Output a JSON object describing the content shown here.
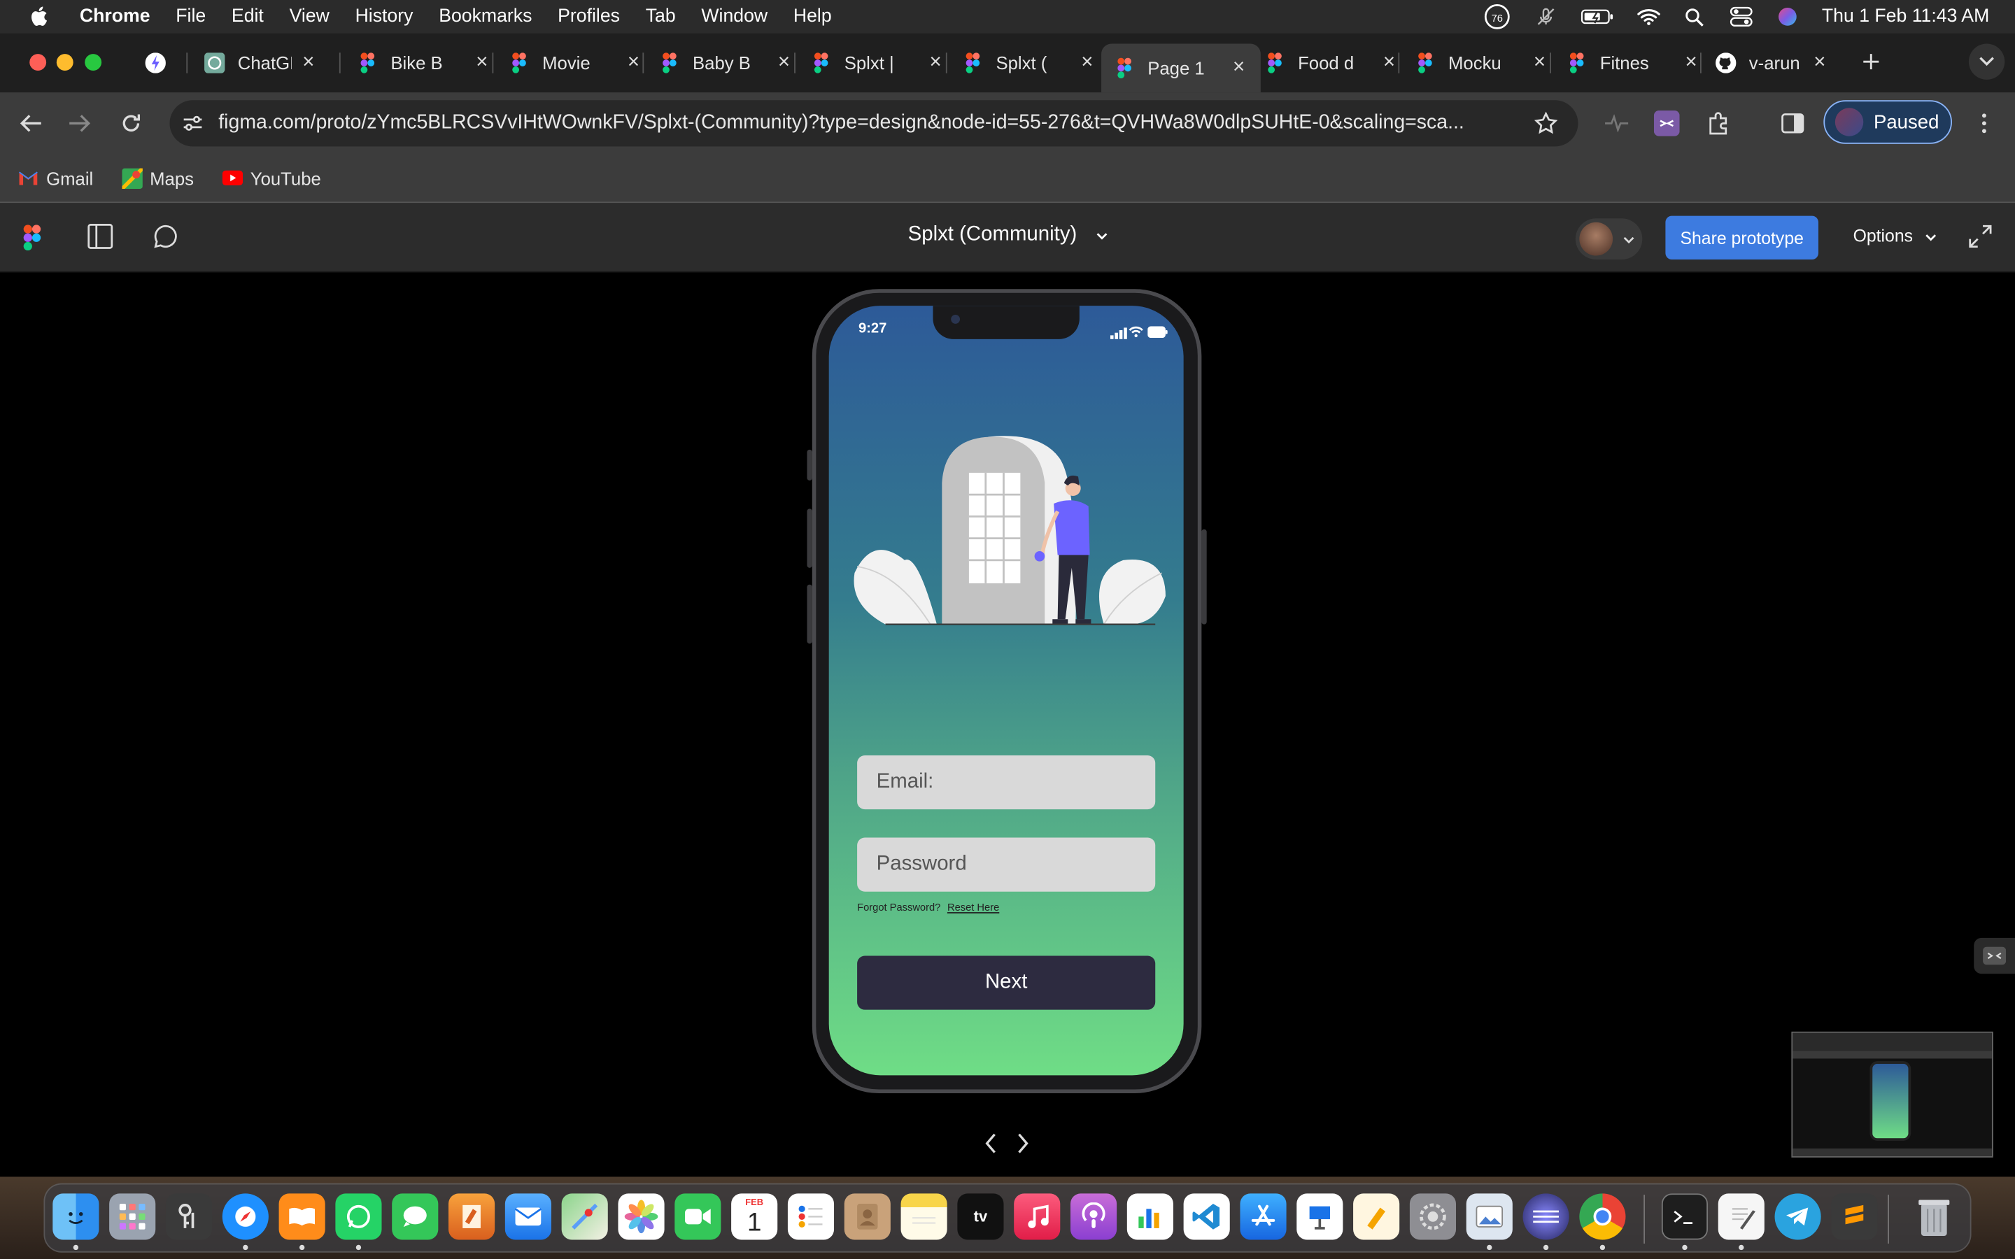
{
  "menubar": {
    "app": "Chrome",
    "items": [
      "File",
      "Edit",
      "View",
      "History",
      "Bookmarks",
      "Profiles",
      "Tab",
      "Window",
      "Help"
    ],
    "notification_count": "76",
    "clock": "Thu 1 Feb  11:43 AM"
  },
  "tabs": [
    {
      "title": "",
      "icon": "bolt-icon"
    },
    {
      "title": "ChatGPT",
      "icon": "chatgpt-icon"
    },
    {
      "title": "Bike B",
      "icon": "figma-icon"
    },
    {
      "title": "Movie",
      "icon": "figma-icon"
    },
    {
      "title": "Baby B",
      "icon": "figma-icon"
    },
    {
      "title": "Splxt |",
      "icon": "figma-icon"
    },
    {
      "title": "Splxt (",
      "icon": "figma-icon"
    },
    {
      "title": "Page 1",
      "icon": "figma-icon",
      "active": true
    },
    {
      "title": "Food d",
      "icon": "figma-icon"
    },
    {
      "title": "Mocku",
      "icon": "figma-icon"
    },
    {
      "title": "Fitnes",
      "icon": "figma-icon"
    },
    {
      "title": "v-arun",
      "icon": "github-icon"
    }
  ],
  "address_bar": {
    "url": "figma.com/proto/zYmc5BLRCSVvIHtWOwnkFV/Splxt-(Community)?type=design&node-id=55-276&t=QVHWa8W0dlpSUHtE-0&scaling=sca..."
  },
  "profile": {
    "label": "Paused"
  },
  "bookmarks": [
    {
      "label": "Gmail",
      "icon": "gmail-icon"
    },
    {
      "label": "Maps",
      "icon": "maps-icon"
    },
    {
      "label": "YouTube",
      "icon": "youtube-icon"
    }
  ],
  "figma": {
    "title": "Splxt (Community)",
    "share_label": "Share prototype",
    "options_label": "Options"
  },
  "phone": {
    "time": "9:27",
    "email_placeholder": "Email:",
    "password_placeholder": "Password",
    "forgot_text": "Forgot Password?",
    "reset_text": "Reset Here",
    "next_label": "Next"
  },
  "dock": {
    "calendar_month": "FEB",
    "calendar_day": "1",
    "tv_label": "tv",
    "apps": [
      "finder-icon",
      "launchpad-icon",
      "keychain-icon",
      "safari-icon",
      "books-icon",
      "whatsapp-icon",
      "messages-icon",
      "pages-icon",
      "mail-icon",
      "maps-icon",
      "photos-icon",
      "facetime-icon",
      "calendar-icon",
      "reminders-icon",
      "contacts-icon",
      "notes-icon",
      "appletv-icon",
      "music-icon",
      "podcasts-icon",
      "numbers-icon",
      "vscode-icon",
      "appstore-icon",
      "keynote-icon",
      "pages-doc-icon",
      "settings-icon",
      "preview-icon",
      "warp-icon",
      "chrome-icon",
      "terminal-icon",
      "textedit-icon",
      "telegram-icon",
      "sublime-icon",
      "trash-icon"
    ]
  },
  "colors": {
    "accent": "#3d7be0",
    "button_dark": "#2d2b40",
    "gradient_top": "#2d5a98",
    "gradient_bottom": "#6fdd86"
  }
}
